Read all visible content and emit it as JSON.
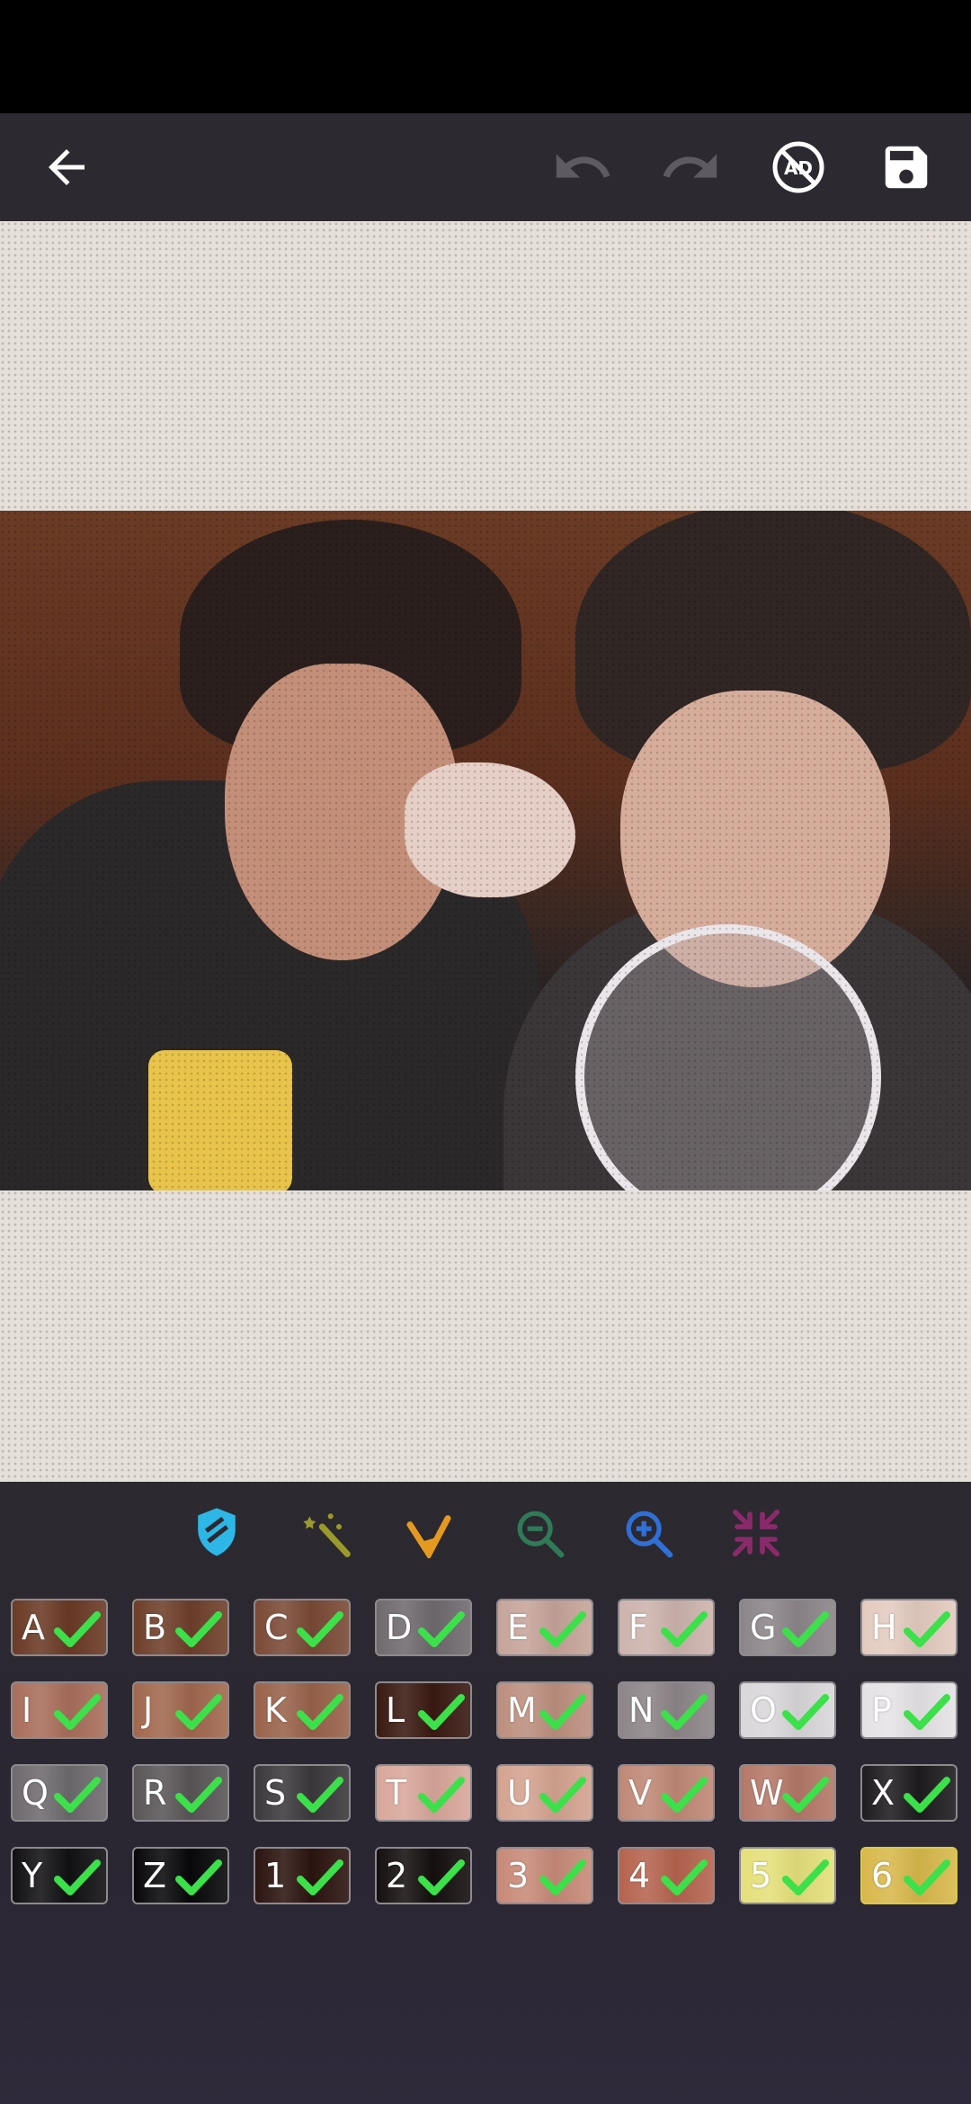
{
  "toolbar": {
    "back": "back-arrow-icon",
    "undo": "undo-icon",
    "redo": "redo-icon",
    "no_ads": "no-ads-icon",
    "save": "save-icon",
    "no_ads_text": "AD"
  },
  "tools": [
    {
      "name": "shield-tool-icon",
      "color": "#2db7e6"
    },
    {
      "name": "magic-wand-icon",
      "color": "#9a9a2a"
    },
    {
      "name": "fill-bucket-icon",
      "color": "#e39a1f"
    },
    {
      "name": "zoom-out-icon",
      "color": "#2f7a57"
    },
    {
      "name": "zoom-in-icon",
      "color": "#2f6fd6"
    },
    {
      "name": "collapse-icon",
      "color": "#8b2a6b"
    }
  ],
  "palette": [
    {
      "label": "A",
      "color": "#6a3a25"
    },
    {
      "label": "B",
      "color": "#6e3f2a"
    },
    {
      "label": "C",
      "color": "#7a4a36"
    },
    {
      "label": "D",
      "color": "#6f6a6e"
    },
    {
      "label": "E",
      "color": "#c6a49a"
    },
    {
      "label": "F",
      "color": "#cdb3ad"
    },
    {
      "label": "G",
      "color": "#8c8589"
    },
    {
      "label": "H",
      "color": "#e3cbc0"
    },
    {
      "label": "I",
      "color": "#a96e5b"
    },
    {
      "label": "J",
      "color": "#a1684e"
    },
    {
      "label": "K",
      "color": "#99624a"
    },
    {
      "label": "L",
      "color": "#3a1a12"
    },
    {
      "label": "M",
      "color": "#bc8f7f"
    },
    {
      "label": "N",
      "color": "#8d8587"
    },
    {
      "label": "O",
      "color": "#d9d7d9"
    },
    {
      "label": "P",
      "color": "#e5e3e5"
    },
    {
      "label": "Q",
      "color": "#6e6a6e"
    },
    {
      "label": "R",
      "color": "#5a5658"
    },
    {
      "label": "S",
      "color": "#3c393c"
    },
    {
      "label": "T",
      "color": "#d8a79a"
    },
    {
      "label": "U",
      "color": "#d4a390"
    },
    {
      "label": "V",
      "color": "#c08876"
    },
    {
      "label": "W",
      "color": "#b47868"
    },
    {
      "label": "X",
      "color": "#1f1c20"
    },
    {
      "label": "Y",
      "color": "#111013"
    },
    {
      "label": "Z",
      "color": "#08070a"
    },
    {
      "label": "1",
      "color": "#2c1410"
    },
    {
      "label": "2",
      "color": "#15100f"
    },
    {
      "label": "3",
      "color": "#c88a78"
    },
    {
      "label": "4",
      "color": "#b5644e"
    },
    {
      "label": "5",
      "color": "#e5e07a"
    },
    {
      "label": "6",
      "color": "#d8b84c"
    }
  ],
  "selected_index": 31
}
